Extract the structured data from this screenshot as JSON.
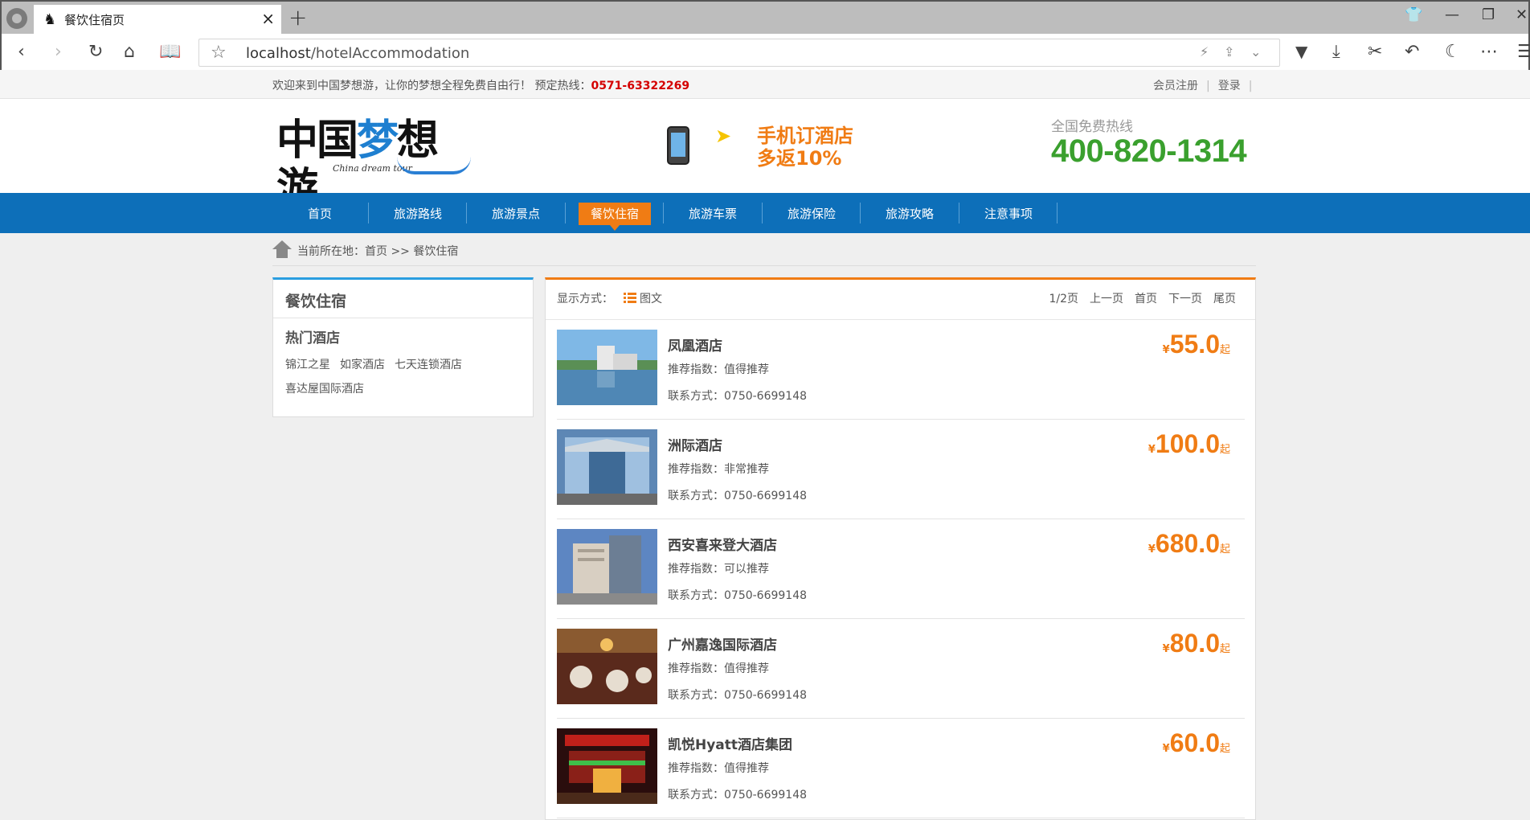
{
  "browser": {
    "tab_title": "餐饮住宿页",
    "url_host": "localhost",
    "url_path": "/hotelAccommodation"
  },
  "topbar": {
    "welcome": "欢迎来到中国梦想游，让你的梦想全程免费自由行！ 预定热线：",
    "phone": "0571-63322269",
    "register": "会员注册",
    "login": "登录"
  },
  "header": {
    "logo_cn_1": "中国",
    "logo_cn_2": "梦",
    "logo_cn_3": "想游",
    "logo_en": "China dream tour",
    "promo_line1": "手机订酒店",
    "promo_line2": "多返10%",
    "hotline_label": "全国免费热线",
    "hotline_number": "400-820-1314"
  },
  "nav": {
    "items": [
      "首页",
      "旅游路线",
      "旅游景点",
      "餐饮住宿",
      "旅游车票",
      "旅游保险",
      "旅游攻略",
      "注意事项"
    ],
    "active_index": 3
  },
  "breadcrumb": {
    "text": "当前所在地：首页 >> 餐饮住宿"
  },
  "sidebar": {
    "title": "餐饮住宿",
    "subtitle": "热门酒店",
    "links": [
      "锦江之星",
      "如家酒店",
      "七天连锁酒店",
      "喜达屋国际酒店"
    ]
  },
  "list": {
    "view_label": "显示方式：",
    "view_mode": "图文",
    "page_info": "1/2页",
    "prev": "上一页",
    "first": "首页",
    "next": "下一页",
    "last": "尾页",
    "hotels": [
      {
        "name": "凤凰酒店",
        "rec": "推荐指数：值得推荐",
        "contact": "联系方式：0750-6699148",
        "price": "55.0"
      },
      {
        "name": "洲际酒店",
        "rec": "推荐指数：非常推荐",
        "contact": "联系方式：0750-6699148",
        "price": "100.0"
      },
      {
        "name": "西安喜来登大酒店",
        "rec": "推荐指数：可以推荐",
        "contact": "联系方式：0750-6699148",
        "price": "680.0"
      },
      {
        "name": "广州嘉逸国际酒店",
        "rec": "推荐指数：值得推荐",
        "contact": "联系方式：0750-6699148",
        "price": "80.0"
      },
      {
        "name": "凯悦Hyatt酒店集团",
        "rec": "推荐指数：值得推荐",
        "contact": "联系方式：0750-6699148",
        "price": "60.0"
      }
    ],
    "currency": "¥",
    "suffix": "起"
  },
  "colors": {
    "nav_blue": "#0d6fb9",
    "accent_orange": "#f07c14",
    "hotline_green": "#3aa02e",
    "sidebar_blue": "#2a9ee0"
  }
}
